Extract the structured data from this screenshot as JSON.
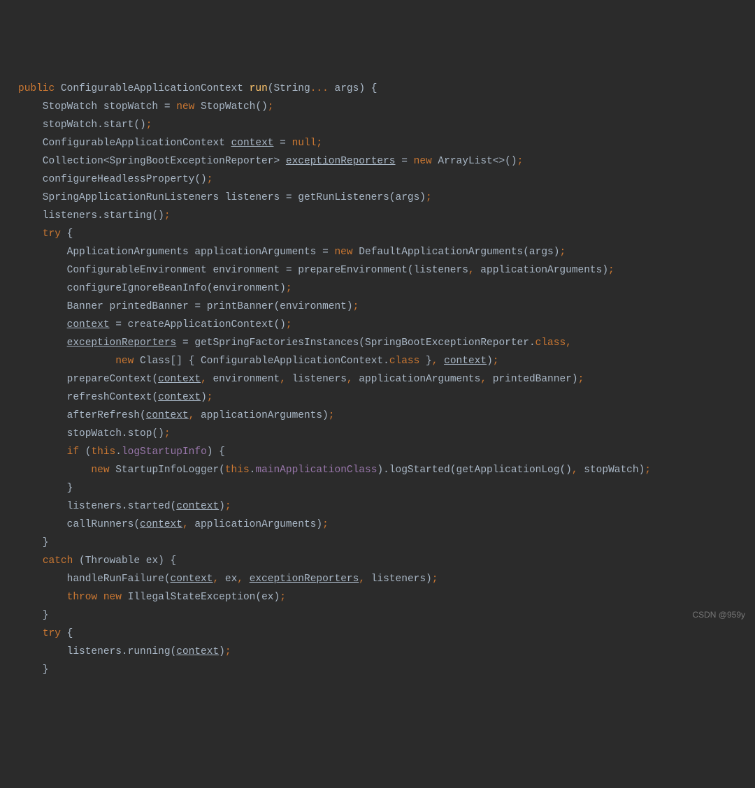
{
  "watermark": "CSDN @959y",
  "code": {
    "lines": [
      [
        [
          "kw",
          "public"
        ],
        [
          "plain",
          " ConfigurableApplicationContext "
        ],
        [
          "mname",
          "run"
        ],
        [
          "plain",
          "(String"
        ],
        [
          "kw",
          "..."
        ],
        [
          "plain",
          " args) {"
        ]
      ],
      [
        [
          "plain",
          "    StopWatch stopWatch = "
        ],
        [
          "kw",
          "new"
        ],
        [
          "plain",
          " StopWatch()"
        ],
        [
          "kw",
          ";"
        ]
      ],
      [
        [
          "plain",
          "    stopWatch.start()"
        ],
        [
          "kw",
          ";"
        ]
      ],
      [
        [
          "plain",
          "    ConfigurableApplicationContext "
        ],
        [
          "und",
          "context"
        ],
        [
          "plain",
          " = "
        ],
        [
          "kw",
          "null;"
        ]
      ],
      [
        [
          "plain",
          "    Collection<SpringBootExceptionReporter> "
        ],
        [
          "und",
          "exceptionReporters"
        ],
        [
          "plain",
          " = "
        ],
        [
          "kw",
          "new"
        ],
        [
          "plain",
          " ArrayList<>()"
        ],
        [
          "kw",
          ";"
        ]
      ],
      [
        [
          "plain",
          "    configureHeadlessProperty()"
        ],
        [
          "kw",
          ";"
        ]
      ],
      [
        [
          "plain",
          "    SpringApplicationRunListeners listeners = getRunListeners(args)"
        ],
        [
          "kw",
          ";"
        ]
      ],
      [
        [
          "plain",
          "    listeners.starting()"
        ],
        [
          "kw",
          ";"
        ]
      ],
      [
        [
          "plain",
          "    "
        ],
        [
          "kw",
          "try"
        ],
        [
          "plain",
          " {"
        ]
      ],
      [
        [
          "plain",
          "        ApplicationArguments applicationArguments = "
        ],
        [
          "kw",
          "new"
        ],
        [
          "plain",
          " DefaultApplicationArguments(args)"
        ],
        [
          "kw",
          ";"
        ]
      ],
      [
        [
          "plain",
          "        ConfigurableEnvironment environment = prepareEnvironment(listeners"
        ],
        [
          "kw",
          ","
        ],
        [
          "plain",
          " applicationArguments)"
        ],
        [
          "kw",
          ";"
        ]
      ],
      [
        [
          "plain",
          "        configureIgnoreBeanInfo(environment)"
        ],
        [
          "kw",
          ";"
        ]
      ],
      [
        [
          "plain",
          "        Banner printedBanner = printBanner(environment)"
        ],
        [
          "kw",
          ";"
        ]
      ],
      [
        [
          "plain",
          "        "
        ],
        [
          "und",
          "context"
        ],
        [
          "plain",
          " = createApplicationContext()"
        ],
        [
          "kw",
          ";"
        ]
      ],
      [
        [
          "plain",
          "        "
        ],
        [
          "und",
          "exceptionReporters"
        ],
        [
          "plain",
          " = getSpringFactoriesInstances(SpringBootExceptionReporter."
        ],
        [
          "kw",
          "class,"
        ]
      ],
      [
        [
          "plain",
          "                "
        ],
        [
          "kw",
          "new"
        ],
        [
          "plain",
          " Class[] { ConfigurableApplicationContext."
        ],
        [
          "kw",
          "class"
        ],
        [
          "plain",
          " }"
        ],
        [
          "kw",
          ","
        ],
        [
          "plain",
          " "
        ],
        [
          "und",
          "context"
        ],
        [
          "plain",
          ")"
        ],
        [
          "kw",
          ";"
        ]
      ],
      [
        [
          "plain",
          "        prepareContext("
        ],
        [
          "und",
          "context"
        ],
        [
          "kw",
          ","
        ],
        [
          "plain",
          " environment"
        ],
        [
          "kw",
          ","
        ],
        [
          "plain",
          " listeners"
        ],
        [
          "kw",
          ","
        ],
        [
          "plain",
          " applicationArguments"
        ],
        [
          "kw",
          ","
        ],
        [
          "plain",
          " printedBanner)"
        ],
        [
          "kw",
          ";"
        ]
      ],
      [
        [
          "plain",
          "        refreshContext("
        ],
        [
          "und",
          "context"
        ],
        [
          "plain",
          ")"
        ],
        [
          "kw",
          ";"
        ]
      ],
      [
        [
          "plain",
          "        afterRefresh("
        ],
        [
          "und",
          "context"
        ],
        [
          "kw",
          ","
        ],
        [
          "plain",
          " applicationArguments)"
        ],
        [
          "kw",
          ";"
        ]
      ],
      [
        [
          "plain",
          "        stopWatch.stop()"
        ],
        [
          "kw",
          ";"
        ]
      ],
      [
        [
          "plain",
          "        "
        ],
        [
          "kw",
          "if"
        ],
        [
          "plain",
          " ("
        ],
        [
          "kw",
          "this"
        ],
        [
          "plain",
          "."
        ],
        [
          "field",
          "logStartupInfo"
        ],
        [
          "plain",
          ") {"
        ]
      ],
      [
        [
          "plain",
          "            "
        ],
        [
          "kw",
          "new"
        ],
        [
          "plain",
          " StartupInfoLogger("
        ],
        [
          "kw",
          "this"
        ],
        [
          "plain",
          "."
        ],
        [
          "field",
          "mainApplicationClass"
        ],
        [
          "plain",
          ").logStarted(getApplicationLog()"
        ],
        [
          "kw",
          ","
        ],
        [
          "plain",
          " stopWatch)"
        ],
        [
          "kw",
          ";"
        ]
      ],
      [
        [
          "plain",
          "        }"
        ]
      ],
      [
        [
          "plain",
          "        listeners.started("
        ],
        [
          "und",
          "context"
        ],
        [
          "plain",
          ")"
        ],
        [
          "kw",
          ";"
        ]
      ],
      [
        [
          "plain",
          "        callRunners("
        ],
        [
          "und",
          "context"
        ],
        [
          "kw",
          ","
        ],
        [
          "plain",
          " applicationArguments)"
        ],
        [
          "kw",
          ";"
        ]
      ],
      [
        [
          "plain",
          "    }"
        ]
      ],
      [
        [
          "plain",
          "    "
        ],
        [
          "kw",
          "catch"
        ],
        [
          "plain",
          " (Throwable ex) {"
        ]
      ],
      [
        [
          "plain",
          "        handleRunFailure("
        ],
        [
          "und",
          "context"
        ],
        [
          "kw",
          ","
        ],
        [
          "plain",
          " ex"
        ],
        [
          "kw",
          ","
        ],
        [
          "plain",
          " "
        ],
        [
          "und",
          "exceptionReporters"
        ],
        [
          "kw",
          ","
        ],
        [
          "plain",
          " listeners)"
        ],
        [
          "kw",
          ";"
        ]
      ],
      [
        [
          "plain",
          "        "
        ],
        [
          "kw",
          "throw new"
        ],
        [
          "plain",
          " IllegalStateException(ex)"
        ],
        [
          "kw",
          ";"
        ]
      ],
      [
        [
          "plain",
          "    }"
        ]
      ],
      [
        [
          "plain",
          ""
        ]
      ],
      [
        [
          "plain",
          "    "
        ],
        [
          "kw",
          "try"
        ],
        [
          "plain",
          " {"
        ]
      ],
      [
        [
          "plain",
          "        listeners.running("
        ],
        [
          "und",
          "context"
        ],
        [
          "plain",
          ")"
        ],
        [
          "kw",
          ";"
        ]
      ],
      [
        [
          "plain",
          "    }"
        ]
      ]
    ]
  }
}
